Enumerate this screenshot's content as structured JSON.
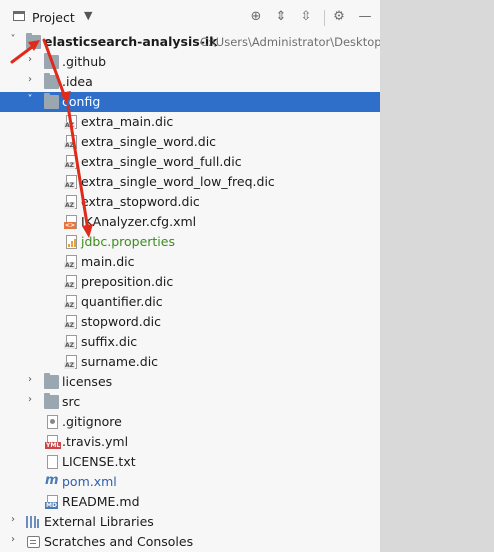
{
  "header": {
    "title": "Project",
    "dropdown": "▼",
    "icons": [
      "locate-icon",
      "expand-all-icon",
      "collapse-all-icon",
      "gear-icon",
      "minimize-icon"
    ]
  },
  "tree": {
    "root": {
      "label": "elasticsearch-analysis-ik",
      "path": "C:\\Users\\Administrator\\Desktop"
    },
    "items": [
      {
        "label": ".github"
      },
      {
        "label": ".idea"
      },
      {
        "label": "config"
      },
      {
        "label": "extra_main.dic"
      },
      {
        "label": "extra_single_word.dic"
      },
      {
        "label": "extra_single_word_full.dic"
      },
      {
        "label": "extra_single_word_low_freq.dic"
      },
      {
        "label": "extra_stopword.dic"
      },
      {
        "label": "IKAnalyzer.cfg.xml"
      },
      {
        "label": "jdbc.properties"
      },
      {
        "label": "main.dic"
      },
      {
        "label": "preposition.dic"
      },
      {
        "label": "quantifier.dic"
      },
      {
        "label": "stopword.dic"
      },
      {
        "label": "suffix.dic"
      },
      {
        "label": "surname.dic"
      },
      {
        "label": "licenses"
      },
      {
        "label": "src"
      },
      {
        "label": ".gitignore"
      },
      {
        "label": ".travis.yml"
      },
      {
        "label": "LICENSE.txt"
      },
      {
        "label": "pom.xml"
      },
      {
        "label": "README.md"
      },
      {
        "label": "External Libraries"
      },
      {
        "label": "Scratches and Consoles"
      }
    ]
  },
  "colors": {
    "selection": "#2f6fca",
    "annotation_arrow": "#e02a1a",
    "properties_text": "#3c8c1e",
    "pom_text": "#2d5fb0"
  }
}
